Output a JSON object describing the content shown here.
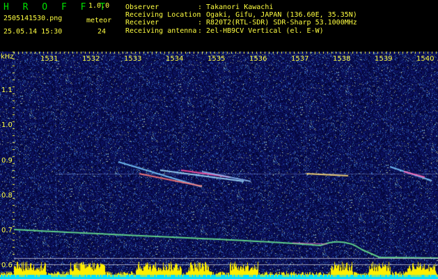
{
  "header": {
    "app_title": "H R O F F T",
    "version": "1.0.0",
    "filename": "2505141530.png",
    "datetime": "25.05.14 15:30",
    "meteor_label": "meteor",
    "meteor_count": "24",
    "info": [
      {
        "label": "Observer",
        "value": ": Takanori Kawachi"
      },
      {
        "label": "Receiving Location",
        "value": ": Ogaki, Gifu, JAPAN (136.60E, 35.35N)"
      },
      {
        "label": "Receiver",
        "value": ": R820T2(RTL-SDR) SDR-Sharp 53.1000MHz"
      },
      {
        "label": "Receiving antenna",
        "value": ": 2el-HB9CV Vertical (el. E-W)"
      }
    ]
  },
  "axes": {
    "unit_label": "kHz",
    "x_ticks": [
      "1531",
      "1532",
      "1533",
      "1534",
      "1535",
      "1536",
      "1537",
      "1538",
      "1539",
      "1540"
    ],
    "y_ticks": [
      "1.1",
      "1.0",
      "0.9",
      "0.8",
      "0.7",
      "0.6"
    ]
  },
  "colors": {
    "background": "#000000",
    "text": "#ffff40",
    "title": "#00e000",
    "spectrogram_bg": "#0a0a3c",
    "level_bar": "#ffee00",
    "baseline": "#00e0ff"
  }
}
